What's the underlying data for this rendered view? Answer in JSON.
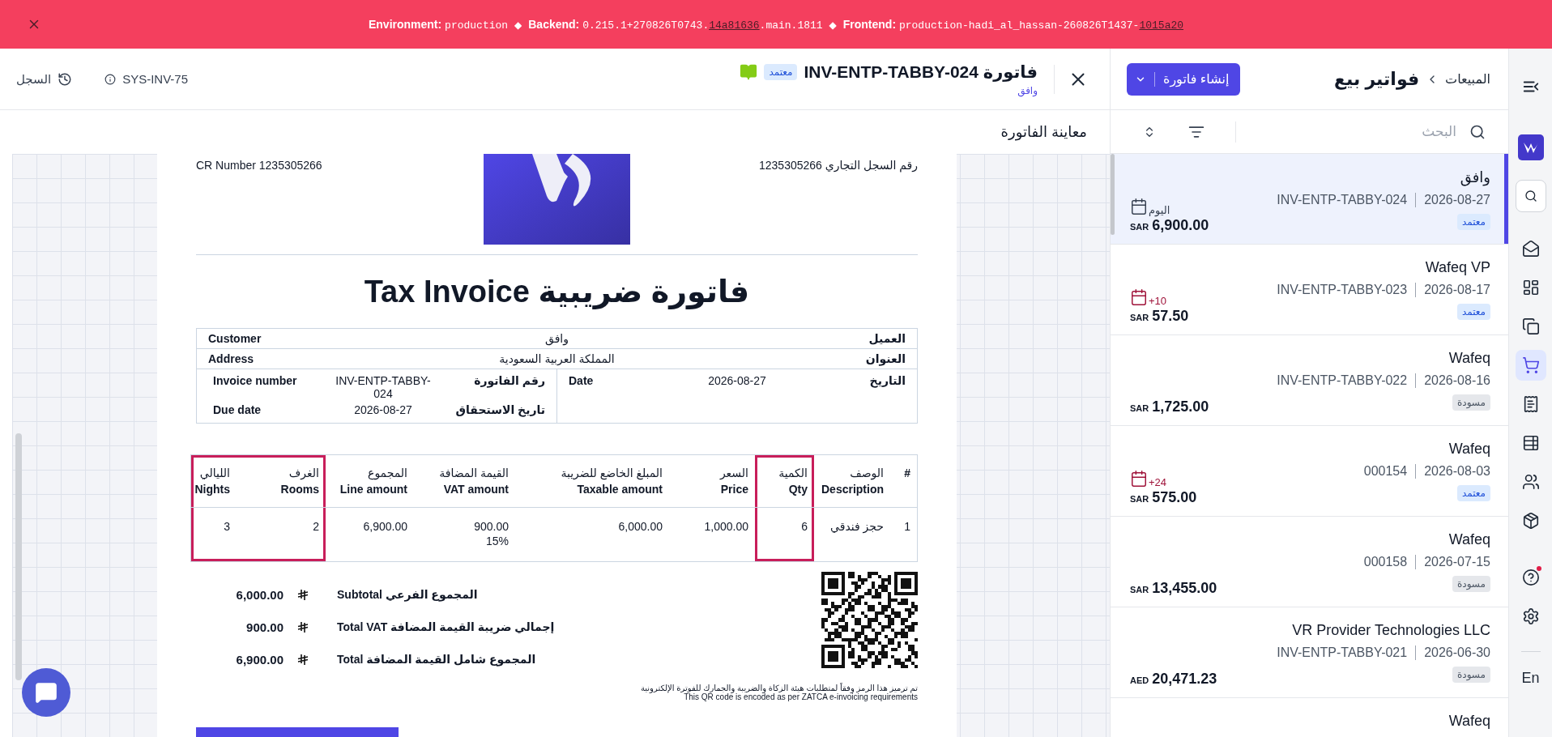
{
  "env_banner": {
    "environment": {
      "label": "Environment:",
      "value": "production"
    },
    "backend": {
      "separator": "◆",
      "label": "Backend:",
      "value": "0.215.1+270826T0743.",
      "link": "14a81636",
      "suffix": ".main.1811"
    },
    "frontend": {
      "separator": "◆",
      "label": "Frontend:",
      "value": "production-hadi_al_hassan-260826T1437-",
      "link": "1015a20"
    }
  },
  "rail": {
    "nav": [
      {
        "selected": false,
        "notification": false
      },
      {
        "selected": false,
        "notification": false
      },
      {
        "selected": false,
        "notification": false
      },
      {
        "selected": true,
        "notification": false
      },
      {
        "selected": false,
        "notification": false
      },
      {
        "selected": false,
        "notification": false
      },
      {
        "selected": false,
        "notification": false
      },
      {
        "selected": false,
        "notification": false
      },
      {
        "selected": false,
        "notification": true
      },
      {
        "selected": false,
        "notification": false
      }
    ],
    "language": "En"
  },
  "list": {
    "breadcrumb": {
      "parent": "المبيعات",
      "current": "فواتير بيع"
    },
    "create_button": "إنشاء فاتورة",
    "search": {
      "placeholder": "البحث"
    },
    "invoices": [
      {
        "customer": "وافق",
        "date": "2026-08-27",
        "number": "INV-ENTP-TABBY-024",
        "status": {
          "kind": "approved",
          "label": "معتمد"
        },
        "due": {
          "text": "اليوم",
          "overdue": false
        },
        "currency": "SAR",
        "amount": "6,900.00",
        "selected": true
      },
      {
        "customer": "Wafeq VP",
        "date": "2026-08-17",
        "number": "INV-ENTP-TABBY-023",
        "status": {
          "kind": "approved",
          "label": "معتمد"
        },
        "due": {
          "text": "+10",
          "overdue": true
        },
        "currency": "SAR",
        "amount": "57.50",
        "selected": false
      },
      {
        "customer": "Wafeq",
        "date": "2026-08-16",
        "number": "INV-ENTP-TABBY-022",
        "status": {
          "kind": "draft",
          "label": "مسودة"
        },
        "currency": "SAR",
        "amount": "1,725.00",
        "selected": false
      },
      {
        "customer": "Wafeq",
        "date": "2026-08-03",
        "number": "000154",
        "status": {
          "kind": "approved",
          "label": "معتمد"
        },
        "due": {
          "text": "+24",
          "overdue": true
        },
        "currency": "SAR",
        "amount": "575.00",
        "selected": false
      },
      {
        "customer": "Wafeq",
        "date": "2026-07-15",
        "number": "000158",
        "status": {
          "kind": "draft",
          "label": "مسودة"
        },
        "currency": "SAR",
        "amount": "13,455.00",
        "selected": false
      },
      {
        "customer": "VR Provider Technologies LLC",
        "date": "2026-06-30",
        "number": "INV-ENTP-TABBY-021",
        "status": {
          "kind": "draft",
          "label": "مسودة"
        },
        "currency": "AED",
        "amount": "20,471.23",
        "selected": false
      },
      {
        "customer": "Wafeq",
        "selected": false
      }
    ]
  },
  "preview": {
    "title": "فاتورة INV-ENTP-TABBY-024",
    "status": {
      "kind": "approved",
      "label": "معتمد"
    },
    "customer_link": "وافق",
    "system_id": "SYS-INV-75",
    "history": "السجل",
    "section_title": "معاينة الفاتورة",
    "document": {
      "cr_ar": "رقم السجل التجاري 1235305266",
      "cr_en": "CR Number 1235305266",
      "title": "فاتورة ضريبية Tax Invoice",
      "info_rows": [
        {
          "label_ar": "العميل",
          "value": "وافق",
          "label_en": "Customer"
        },
        {
          "label_ar": "العنوان",
          "value": "المملكة العربية السعودية",
          "label_en": "Address"
        }
      ],
      "info_right": [
        {
          "label_ar": "التاريخ",
          "value": "2026-08-27",
          "label_en": "Date"
        }
      ],
      "info_left": [
        {
          "label_ar": "رقم الفاتورة",
          "value": "INV-ENTP-TABBY-024",
          "label_en": "Invoice number"
        },
        {
          "label_ar": "تاريخ الاستحقاق",
          "value": "2026-08-27",
          "label_en": "Due date"
        }
      ],
      "columns": [
        {
          "en": "#",
          "highlighted": false
        },
        {
          "ar": "الوصف",
          "en": "Description",
          "highlighted": false
        },
        {
          "ar": "الكمية",
          "en": "Qty",
          "highlighted": true
        },
        {
          "ar": "السعر",
          "en": "Price",
          "highlighted": false
        },
        {
          "ar": "المبلغ الخاضع للضريبة",
          "en": "Taxable amount",
          "highlighted": false
        },
        {
          "ar": "القيمة المضافة",
          "en": "VAT amount",
          "highlighted": false
        },
        {
          "ar": "المجموع",
          "en": "Line amount",
          "highlighted": false
        },
        {
          "ar": "الغرف",
          "en": "Rooms",
          "highlighted": true
        },
        {
          "ar": "الليالي",
          "en": "Nights",
          "highlighted": true
        }
      ],
      "rows": [
        {
          "cells": [
            {
              "text": "1"
            },
            {
              "text": "حجز فندقي"
            },
            {
              "text": "6"
            },
            {
              "text": "1,000.00"
            },
            {
              "text": "6,000.00"
            },
            {
              "text": "900.00",
              "note": "15%"
            },
            {
              "text": "6,900.00"
            },
            {
              "text": "2"
            },
            {
              "text": "3"
            }
          ]
        }
      ],
      "totals": [
        {
          "label": "المجموع الفرعي Subtotal",
          "amount": "6,000.00"
        },
        {
          "label": "إجمالي ضريبة القيمة المضافة Total VAT",
          "amount": "900.00"
        },
        {
          "label": "المجموع شامل القيمة المضافة Total",
          "amount": "6,900.00"
        }
      ],
      "qr_note": [
        "تم ترميز هذا الرمز وفقاً لمتطلبات هيئة الزكاة والضريبة والجمارك للفوترة الإلكترونية",
        "This QR code is encoded as per ZATCA e-invoicing requirements"
      ]
    }
  }
}
